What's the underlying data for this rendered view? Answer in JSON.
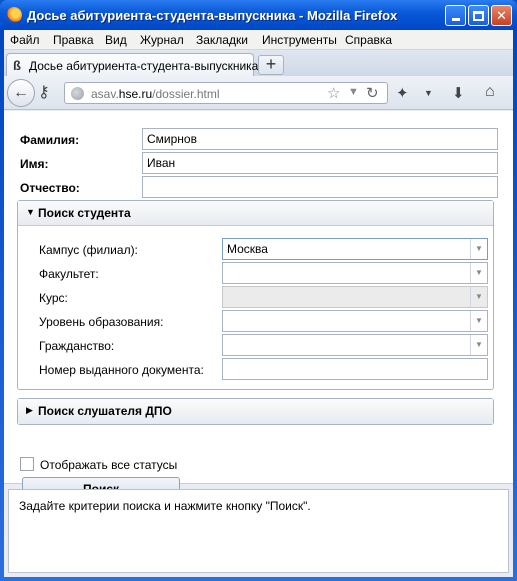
{
  "window": {
    "title": "Досье абитуриента-студента-выпускника - Mozilla Firefox"
  },
  "menu": [
    "Файл",
    "Правка",
    "Вид",
    "Журнал",
    "Закладки",
    "Инструменты",
    "Справка"
  ],
  "tab": {
    "label": "Досье абитуриента-студента-выпускника",
    "new_tab_label": "+"
  },
  "url": {
    "prefix": "asav.",
    "domain": "hse.ru",
    "path": "/dossier.html"
  },
  "form": {
    "surname_label": "Фамилия:",
    "surname_value": "Смирнов",
    "name_label": "Имя:",
    "name_value": "Иван",
    "patronymic_label": "Отчество:",
    "patronymic_value": ""
  },
  "student_search": {
    "title": "Поиск студента",
    "expanded": true,
    "campus_label": "Кампус (филиал):",
    "campus_value": "Москва",
    "faculty_label": "Факультет:",
    "faculty_value": "",
    "course_label": "Курс:",
    "course_value": "",
    "level_label": "Уровень образования:",
    "level_value": "",
    "citizenship_label": "Гражданство:",
    "citizenship_value": "",
    "document_label": "Номер выданного документа:",
    "document_value": ""
  },
  "dpo_search": {
    "title": "Поиск слушателя ДПО",
    "expanded": false
  },
  "show_all_statuses_label": "Отображать все статусы",
  "search_button_label": "Поиск",
  "result_text": "Задайте критерии поиска и нажмите кнопку \"Поиск\"."
}
